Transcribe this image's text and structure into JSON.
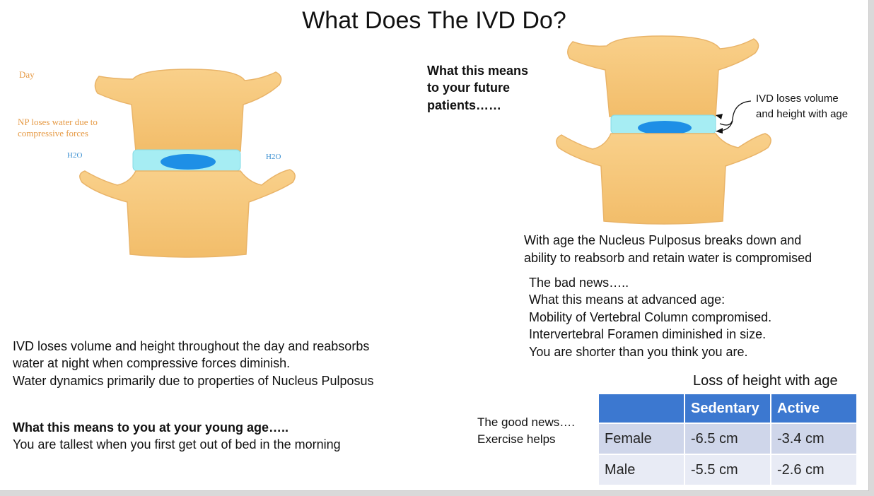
{
  "title": "What Does The IVD Do?",
  "left_diagram": {
    "day_label": "Day",
    "np_label_line1": "NP loses water due to",
    "np_label_line2": "compressive forces",
    "h2o_left": "H2O",
    "h2o_right": "H2O"
  },
  "left_text": {
    "line1": "IVD loses volume and height throughout the day and reabsorbs",
    "line2": "water at night when compressive forces diminish.",
    "line3": "Water dynamics primarily due to properties of Nucleus Pulposus",
    "young_heading": "What this means to you at your young age…..",
    "young_text": "You are tallest when you first get out of bed in the morning"
  },
  "future": {
    "line1": "What this means",
    "line2": "to your future",
    "line3": "patients……"
  },
  "right_diagram": {
    "callout_line1": "IVD loses volume",
    "callout_line2": "and height with age"
  },
  "age_text": {
    "line1": "With age the Nucleus Pulposus breaks down and",
    "line2": "ability to reabsorb and retain water is compromised"
  },
  "bad_news": {
    "line1": "The bad news…..",
    "line2": "What this means at advanced age:",
    "line3": "Mobility of Vertebral Column compromised.",
    "line4": "Intervertebral Foramen diminished in size.",
    "line5": "You are shorter than you think you are."
  },
  "good_news": {
    "line1": "The good news….",
    "line2": "Exercise helps"
  },
  "table": {
    "caption": "Loss of height with age",
    "headers": [
      "",
      "Sedentary",
      "Active"
    ],
    "rows": [
      [
        "Female",
        "-6.5 cm",
        "-3.4 cm"
      ],
      [
        "Male",
        "-5.5 cm",
        "-2.6 cm"
      ]
    ]
  },
  "colors": {
    "bone": "#f7c77a",
    "disc": "#a6edf3",
    "nucleus": "#1e8fe6",
    "table_header": "#3c78d0"
  }
}
